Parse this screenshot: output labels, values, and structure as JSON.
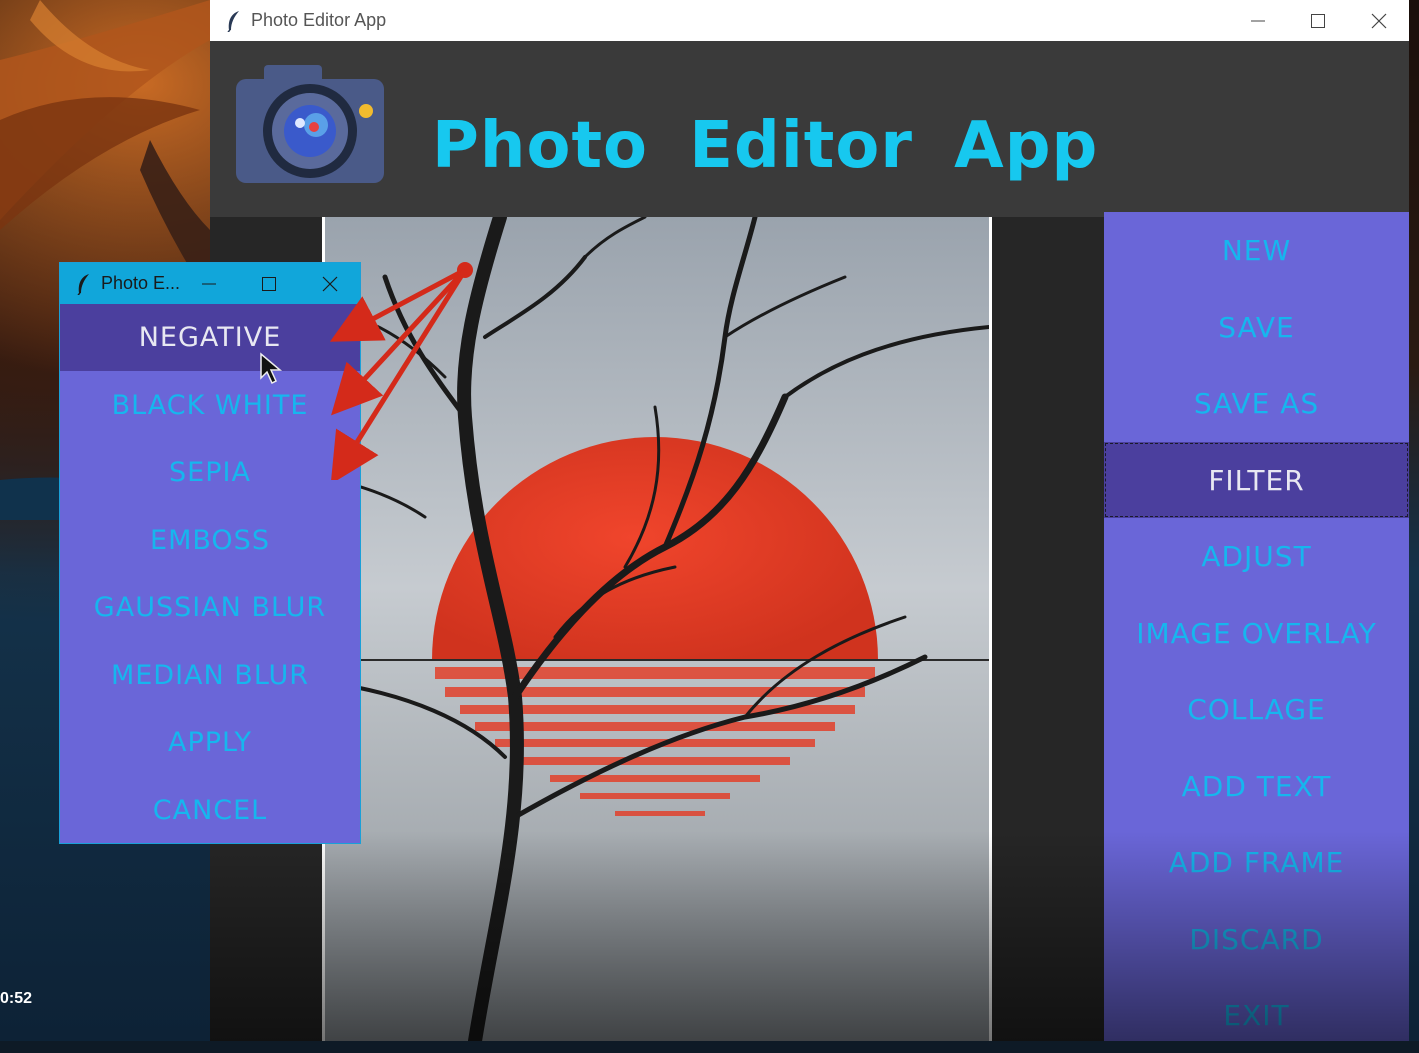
{
  "desktop": {
    "time_fragment": "0:52"
  },
  "main_window": {
    "title": "Photo Editor App",
    "heading": "Photo Editor App",
    "side_menu": [
      {
        "label": "NEW",
        "active": false
      },
      {
        "label": "SAVE",
        "active": false
      },
      {
        "label": "SAVE AS",
        "active": false
      },
      {
        "label": "FILTER",
        "active": true
      },
      {
        "label": "ADJUST",
        "active": false
      },
      {
        "label": "IMAGE OVERLAY",
        "active": false
      },
      {
        "label": "COLLAGE",
        "active": false
      },
      {
        "label": "ADD TEXT",
        "active": false
      },
      {
        "label": "ADD FRAME",
        "active": false
      },
      {
        "label": "DISCARD",
        "active": false
      },
      {
        "label": "EXIT",
        "active": false
      }
    ]
  },
  "filter_dialog": {
    "title": "Photo E...",
    "items": [
      {
        "label": "NEGATIVE",
        "active": true
      },
      {
        "label": "BLACK WHITE",
        "active": false
      },
      {
        "label": "SEPIA",
        "active": false
      },
      {
        "label": "EMBOSS",
        "active": false
      },
      {
        "label": "GAUSSIAN BLUR",
        "active": false
      },
      {
        "label": "MEDIAN BLUR",
        "active": false
      },
      {
        "label": "APPLY",
        "active": false
      },
      {
        "label": "CANCEL",
        "active": false
      }
    ]
  },
  "colors": {
    "menu_bg": "#6a66d8",
    "menu_active_bg": "#4b3f9e",
    "menu_text": "#16b6ee",
    "heading_text": "#17c8ef",
    "dialog_titlebar": "#11a6da",
    "annotation_arrow": "#d42a1a"
  },
  "icons": {
    "app_icon": "feather-icon",
    "logo": "camera-icon",
    "minimize": "minimize-icon",
    "maximize": "maximize-icon",
    "close": "close-icon",
    "pointer": "mouse-cursor-icon"
  }
}
